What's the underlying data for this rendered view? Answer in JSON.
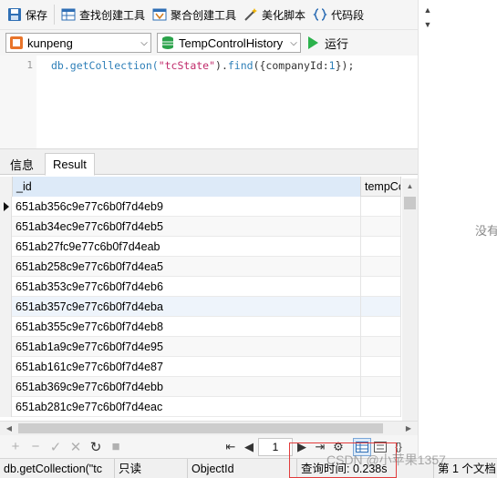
{
  "toolbar": {
    "save": "保存",
    "find_builder": "查找创建工具",
    "aggregate_builder": "聚合创建工具",
    "beautify": "美化脚本",
    "code_snippet": "代码段"
  },
  "connection": {
    "name": "kunpeng"
  },
  "collection": {
    "name": "TempControlHistory"
  },
  "run_label": "运行",
  "editor": {
    "line_number": "1",
    "code_parts": {
      "p1": "db.getCollection(",
      "p2": "\"tcState\"",
      "p3": ").",
      "p4": "find",
      "p5": "({companyId:",
      "p6": "1",
      "p7": "});"
    }
  },
  "tabs": {
    "info": "信息",
    "result": "Result"
  },
  "grid": {
    "columns": [
      "_id",
      "tempCo"
    ],
    "rows": [
      "651ab356c9e77c6b0f7d4eb9",
      "651ab34ec9e77c6b0f7d4eb5",
      "651ab27fc9e77c6b0f7d4eab",
      "651ab258c9e77c6b0f7d4ea5",
      "651ab353c9e77c6b0f7d4eb6",
      "651ab357c9e77c6b0f7d4eba",
      "651ab355c9e77c6b0f7d4eb8",
      "651ab1a9c9e77c6b0f7d4e95",
      "651ab161c9e77c6b0f7d4e87",
      "651ab369c9e77c6b0f7d4ebb",
      "651ab281c9e77c6b0f7d4eac"
    ]
  },
  "pager": {
    "page": "1"
  },
  "status": {
    "query": "db.getCollection(\"tc",
    "readonly": "只读",
    "type": "ObjectId",
    "query_time": "查询时间: 0.238s",
    "doc_count": "第 1 个文档"
  },
  "right_panel": {
    "text": "没有"
  },
  "watermark": "CSDN @小苹果1357",
  "colors": {
    "accent": "#2bb24c",
    "highlight_box": "#e23b3b",
    "selected_header": "#ddeaf8"
  }
}
